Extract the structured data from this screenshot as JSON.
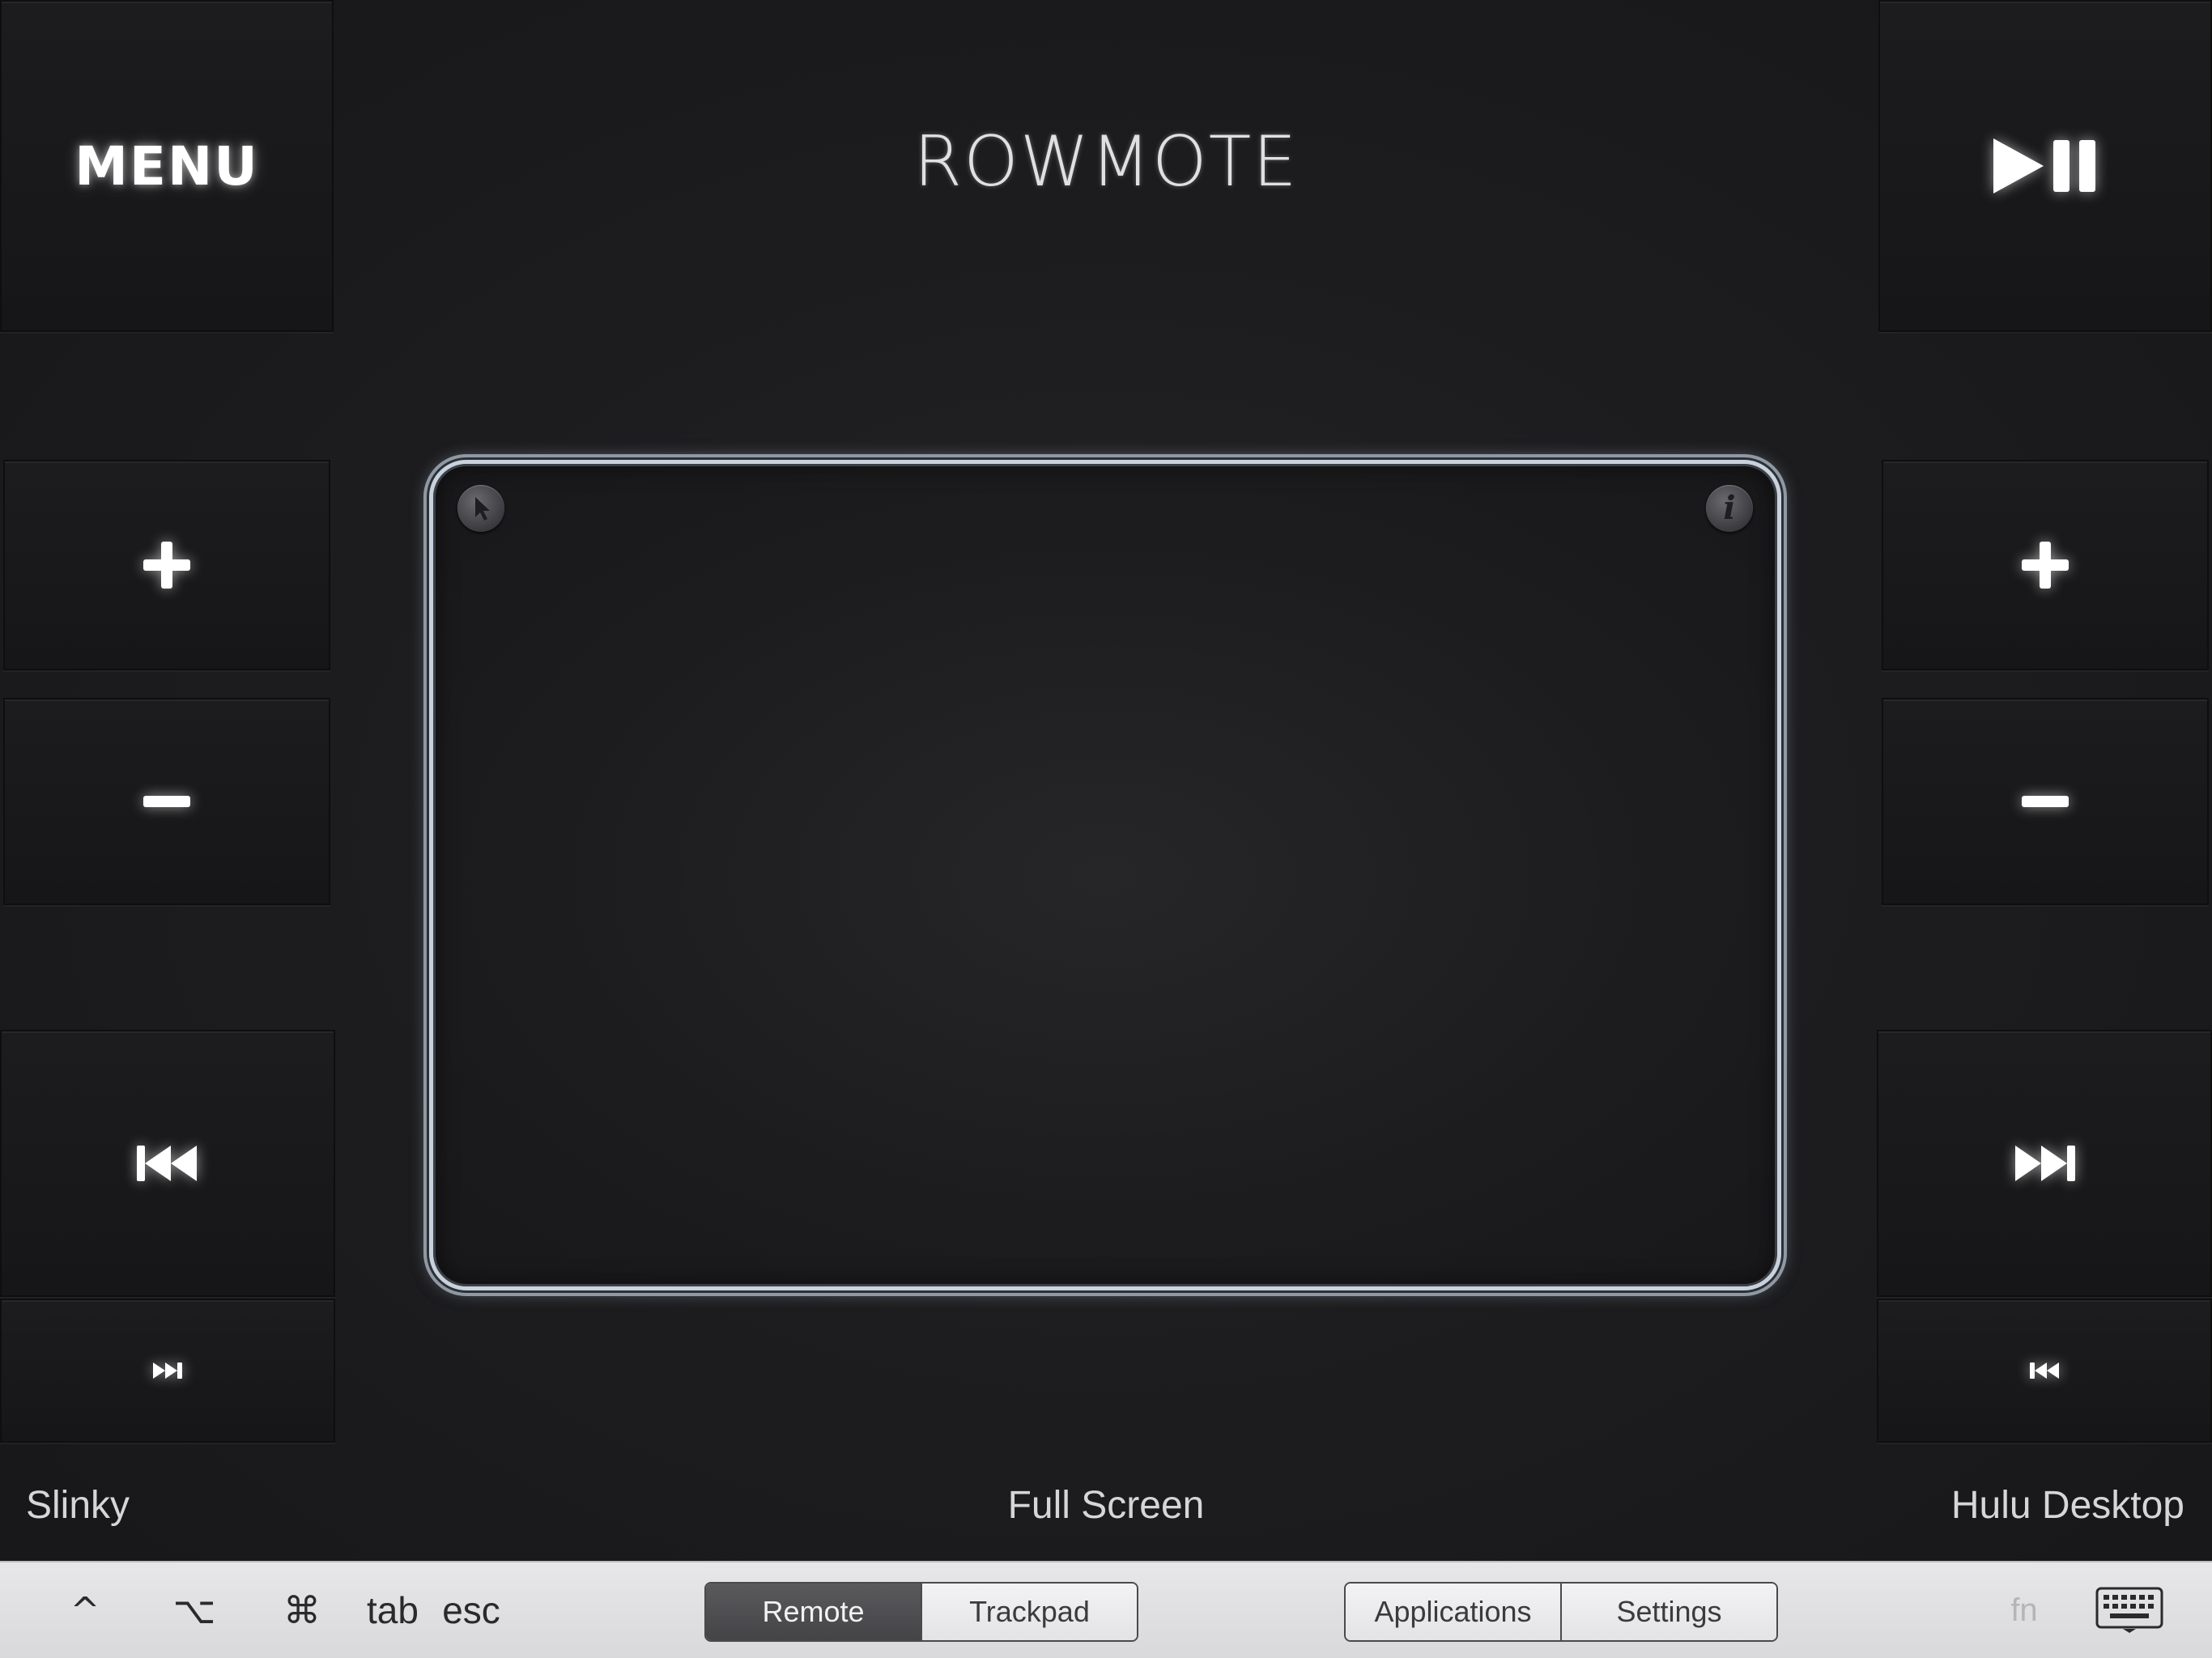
{
  "app": {
    "title": "ROWMOTE"
  },
  "left_panel": {
    "menu_label": "MENU"
  },
  "trackpad": {
    "info_glyph": "i"
  },
  "labels": {
    "left": "Slinky",
    "center": "Full Screen",
    "right": "Hulu Desktop"
  },
  "bottom_bar": {
    "modifiers": [
      {
        "name": "control",
        "glyph": "^"
      },
      {
        "name": "option",
        "glyph": "⌥"
      },
      {
        "name": "command",
        "glyph": "⌘"
      },
      {
        "name": "tab",
        "glyph": "tab"
      },
      {
        "name": "esc",
        "glyph": "esc"
      }
    ],
    "mode_tabs": [
      "Remote",
      "Trackpad"
    ],
    "active_mode": "Remote",
    "nav_tabs": [
      "Applications",
      "Settings"
    ],
    "fn_label": "fn"
  },
  "icons": {
    "play_pause": "play-pause-icon",
    "plus": "plus-icon",
    "minus": "minus-icon",
    "skip_back": "skip-back-icon",
    "skip_forward": "skip-forward-icon",
    "cursor": "cursor-icon",
    "info": "info-icon",
    "keyboard": "keyboard-icon"
  },
  "colors": {
    "background": "#1d1d1f",
    "trackpad_border": "#c9d2dc",
    "bottom_bar": "#e0e0e3",
    "active_segment": "#4d4d50"
  }
}
